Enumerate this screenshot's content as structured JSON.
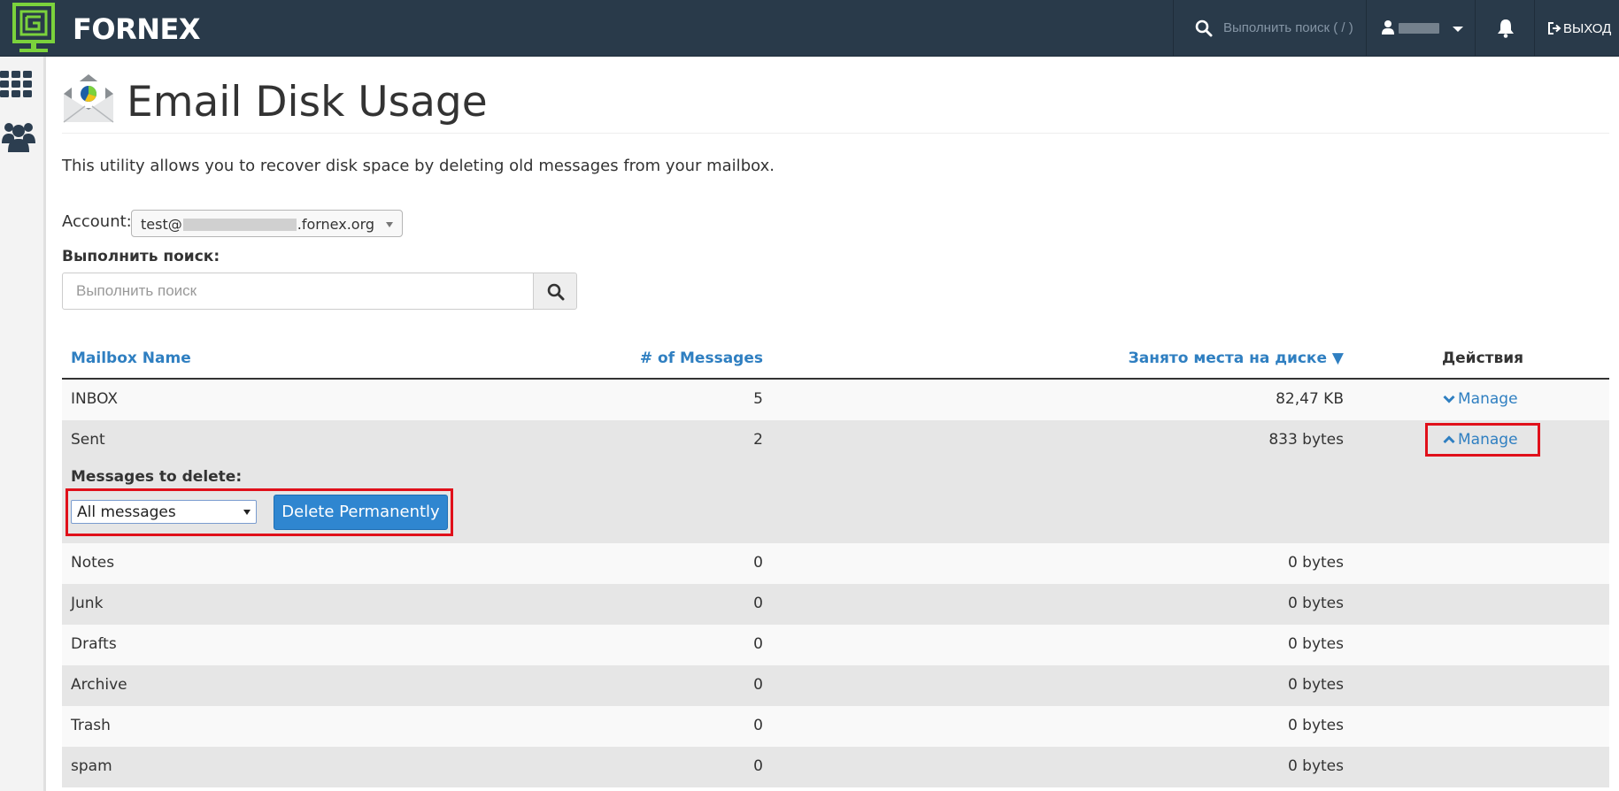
{
  "topbar": {
    "brand": "FORNEX",
    "search_placeholder": "Выполнить поиск ( / )",
    "logout_label": "ВЫХОД",
    "colors": {
      "bar": "#293a4a",
      "logo_green": "#7bd23c"
    },
    "icons": [
      "fornex-logo-icon",
      "search-icon",
      "user-icon",
      "caret-down-icon",
      "bell-icon",
      "logout-icon"
    ]
  },
  "sidebar": {
    "icons": [
      "apps-grid-icon",
      "users-icon"
    ]
  },
  "header": {
    "title": "Email Disk Usage",
    "icon": "envelope-pie-icon"
  },
  "description": "This utility allows you to recover disk space by deleting old messages from your mailbox.",
  "account": {
    "label": "Account:",
    "value_prefix": "test@",
    "value_suffix": ".fornex.org"
  },
  "search": {
    "label": "Выполнить поиск:",
    "placeholder": "Выполнить поиск"
  },
  "table": {
    "headers": {
      "name": "Mailbox Name",
      "count": "# of Messages",
      "size": "Занято места на диске ▼",
      "actions": "Действия"
    },
    "manage_label": "Manage",
    "rows": [
      {
        "name": "INBOX",
        "count": "5",
        "size": "82,47 KB",
        "manage": true,
        "expanded": false
      },
      {
        "name": "Sent",
        "count": "2",
        "size": "833 bytes",
        "manage": true,
        "expanded": true
      },
      {
        "name": "Notes",
        "count": "0",
        "size": "0 bytes"
      },
      {
        "name": "Junk",
        "count": "0",
        "size": "0 bytes"
      },
      {
        "name": "Drafts",
        "count": "0",
        "size": "0 bytes"
      },
      {
        "name": "Archive",
        "count": "0",
        "size": "0 bytes"
      },
      {
        "name": "Trash",
        "count": "0",
        "size": "0 bytes"
      },
      {
        "name": "spam",
        "count": "0",
        "size": "0 bytes"
      }
    ],
    "expanded_panel": {
      "label": "Messages to delete:",
      "select_value": "All messages",
      "delete_button": "Delete Permanently"
    }
  },
  "highlight_color": "#e0101a",
  "link_color": "#2f7fc1"
}
